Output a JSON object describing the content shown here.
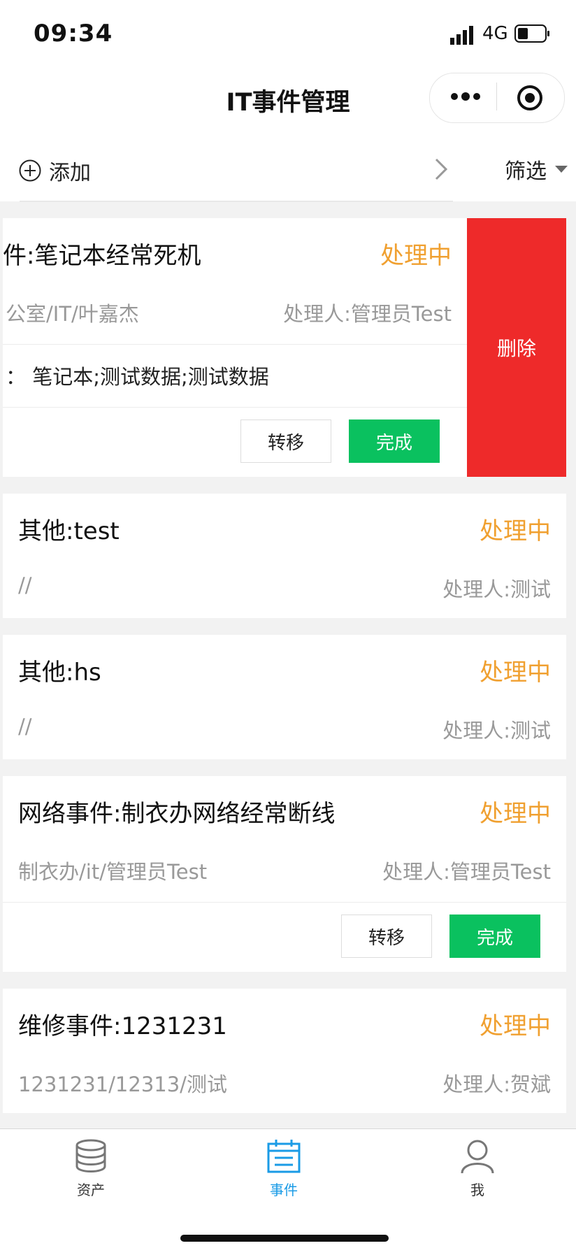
{
  "status_bar": {
    "time": "09:34",
    "network": "4G"
  },
  "nav": {
    "title": "IT事件管理",
    "more_icon": "more-dots-icon",
    "target_icon": "target-icon"
  },
  "toolbar": {
    "add_label": "添加",
    "filter_label": "筛选"
  },
  "events": [
    {
      "title": "件:笔记本经常死机",
      "status": "处理中",
      "location": "公室/IT/叶嘉杰",
      "handler": "处理人:管理员Test",
      "detail": "：  笔记本;测试数据;测试数据",
      "transfer_label": "转移",
      "complete_label": "完成",
      "delete_label": "删除"
    },
    {
      "title": "其他:test",
      "status": "处理中",
      "location": "//",
      "handler": "处理人:测试"
    },
    {
      "title": "其他:hs",
      "status": "处理中",
      "location": "//",
      "handler": "处理人:测试"
    },
    {
      "title": "网络事件:制衣办网络经常断线",
      "status": "处理中",
      "location": "制衣办/it/管理员Test",
      "handler": "处理人:管理员Test",
      "transfer_label": "转移",
      "complete_label": "完成"
    },
    {
      "title": "维修事件:1231231",
      "status": "处理中",
      "location": "1231231/12313/测试",
      "handler": "处理人:贺斌"
    }
  ],
  "tabs": [
    {
      "label": "资产",
      "icon": "database-icon",
      "active": false
    },
    {
      "label": "事件",
      "icon": "calendar-icon",
      "active": true
    },
    {
      "label": "我",
      "icon": "user-icon",
      "active": false
    }
  ],
  "colors": {
    "status": "#f0a030",
    "complete": "#0ac15f",
    "delete": "#ee2a2a",
    "tab_active": "#1a9be6"
  }
}
